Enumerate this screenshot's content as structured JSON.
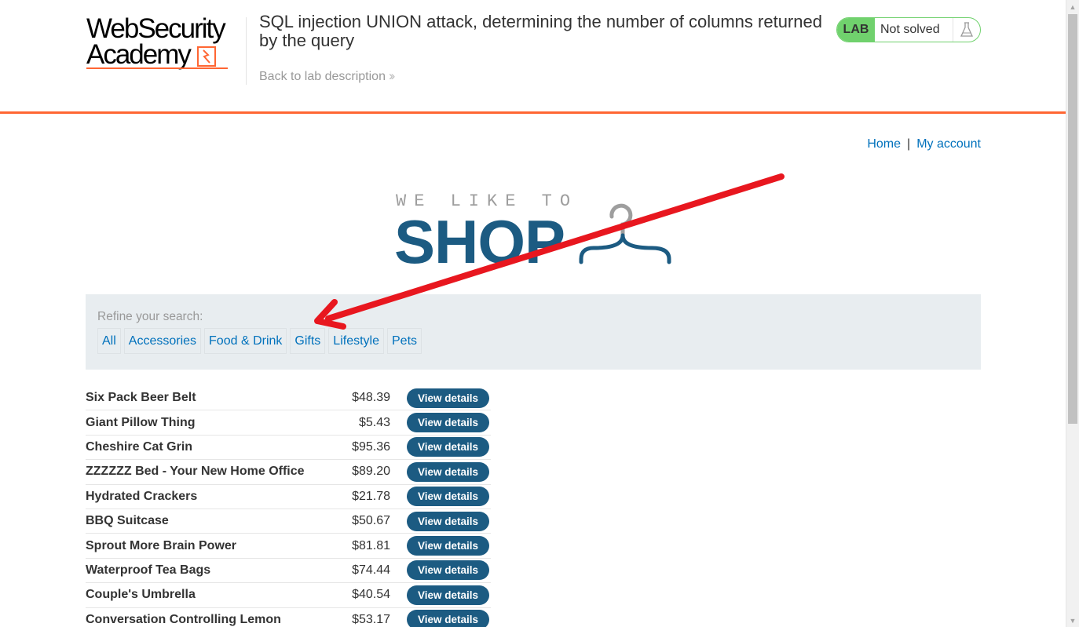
{
  "academy_header": {
    "logo_line1": "WebSecurity",
    "logo_line2": "Academy",
    "lab_title": "SQL injection UNION attack, determining the number of columns returned by the query",
    "back_link": "Back to lab description",
    "lab_badge": "LAB",
    "lab_status": "Not solved",
    "accent_color": "#ff6633",
    "status_color": "#70d16d"
  },
  "nav": {
    "home": "Home",
    "separator": "|",
    "my_account": "My account"
  },
  "banner": {
    "small_text": "WE LIKE TO",
    "big_text": "SHOP"
  },
  "filter": {
    "title": "Refine your search:",
    "categories": [
      "All",
      "Accessories",
      "Food & Drink",
      "Gifts",
      "Lifestyle",
      "Pets"
    ]
  },
  "products": [
    {
      "name": "Six Pack Beer Belt",
      "price": "$48.39",
      "button": "View details"
    },
    {
      "name": "Giant Pillow Thing",
      "price": "$5.43",
      "button": "View details"
    },
    {
      "name": "Cheshire Cat Grin",
      "price": "$95.36",
      "button": "View details"
    },
    {
      "name": "ZZZZZZ Bed - Your New Home Office",
      "price": "$89.20",
      "button": "View details"
    },
    {
      "name": "Hydrated Crackers",
      "price": "$21.78",
      "button": "View details"
    },
    {
      "name": "BBQ Suitcase",
      "price": "$50.67",
      "button": "View details"
    },
    {
      "name": "Sprout More Brain Power",
      "price": "$81.81",
      "button": "View details"
    },
    {
      "name": "Waterproof Tea Bags",
      "price": "$74.44",
      "button": "View details"
    },
    {
      "name": "Couple's Umbrella",
      "price": "$40.54",
      "button": "View details"
    },
    {
      "name": "Conversation Controlling Lemon",
      "price": "$53.17",
      "button": "View details"
    }
  ],
  "annotation": {
    "arrow_color": "#e8171f",
    "target": "Gifts"
  }
}
